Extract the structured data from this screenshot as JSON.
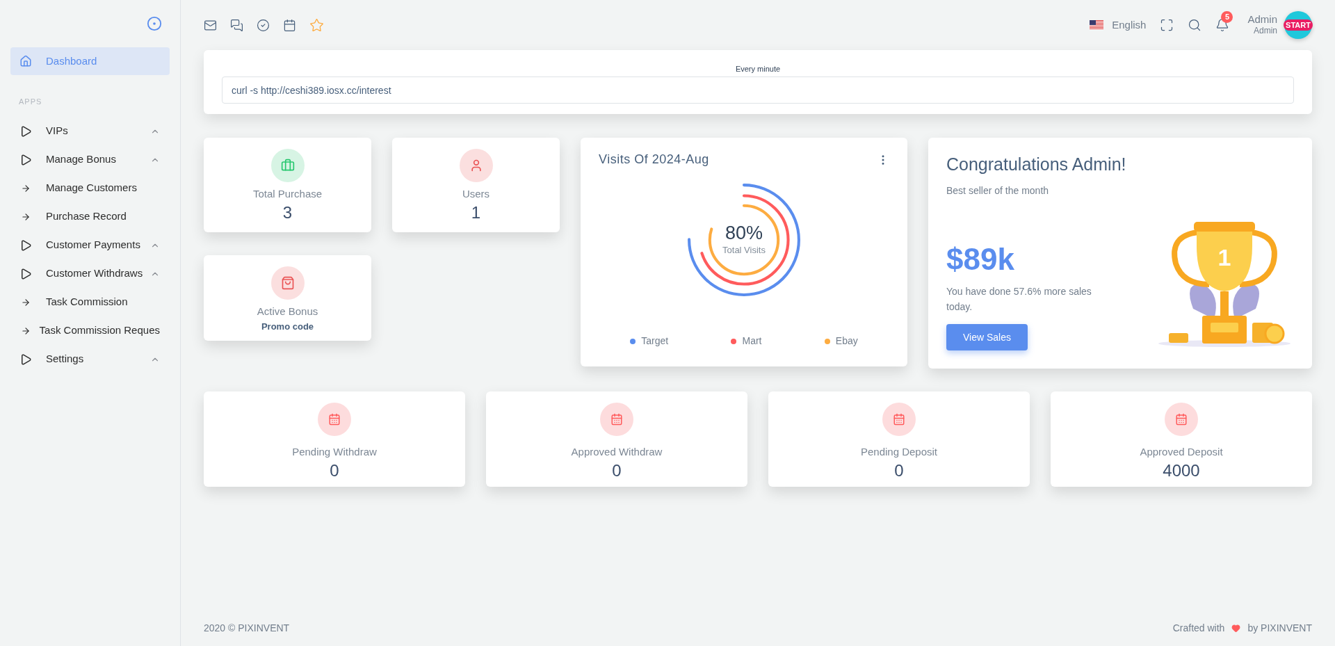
{
  "sidebar": {
    "section_label": "APPS",
    "items": [
      {
        "label": "Dashboard",
        "kind": "home",
        "selected": true
      },
      {
        "label": "VIPs",
        "kind": "group",
        "selected": false
      },
      {
        "label": "Manage Bonus",
        "kind": "group",
        "selected": false
      },
      {
        "label": "Manage Customers",
        "kind": "link",
        "selected": false
      },
      {
        "label": "Purchase Record",
        "kind": "link",
        "selected": false
      },
      {
        "label": "Customer Payments",
        "kind": "group",
        "selected": false
      },
      {
        "label": "Customer Withdraws",
        "kind": "group",
        "selected": false
      },
      {
        "label": "Task Commission",
        "kind": "link",
        "selected": false
      },
      {
        "label": "Task Commission Reques",
        "kind": "link",
        "selected": false
      },
      {
        "label": "Settings",
        "kind": "group",
        "selected": false
      }
    ]
  },
  "navbar": {
    "language": "English",
    "notification_count": "5",
    "user_name": "Admin",
    "user_role": "Admin",
    "avatar_text": "START"
  },
  "cron": {
    "label": "Every minute",
    "value": "curl -s http://ceshi389.iosx.cc/interest"
  },
  "stats": [
    {
      "label": "Total Purchase",
      "value": "3",
      "color": "#28c76f"
    },
    {
      "label": "Users",
      "value": "1",
      "color": "#ea5455"
    },
    {
      "label": "Active Bonus",
      "value": "Promo code",
      "color": "#ea5455"
    }
  ],
  "visits": {
    "title": "Visits Of 2024-Aug",
    "center_value": "80%",
    "center_label": "Total Visits",
    "legend": [
      {
        "label": "Target",
        "color": "#5a8dee"
      },
      {
        "label": "Mart",
        "color": "#ff5b5c"
      },
      {
        "label": "Ebay",
        "color": "#fdac41"
      }
    ]
  },
  "congrats": {
    "title": "Congratulations Admin!",
    "subtitle": "Best seller of the month",
    "amount": "$89k",
    "text": "You have done 57.6% more sales today.",
    "button": "View Sales",
    "trophy_number": "1"
  },
  "transactions": [
    {
      "label": "Pending Withdraw",
      "value": "0"
    },
    {
      "label": "Approved Withdraw",
      "value": "0"
    },
    {
      "label": "Pending Deposit",
      "value": "0"
    },
    {
      "label": "Approved Deposit",
      "value": "4000"
    }
  ],
  "footer": {
    "copyright": "2020 © PIXINVENT",
    "crafted": "Crafted with",
    "by": "by PIXINVENT"
  }
}
